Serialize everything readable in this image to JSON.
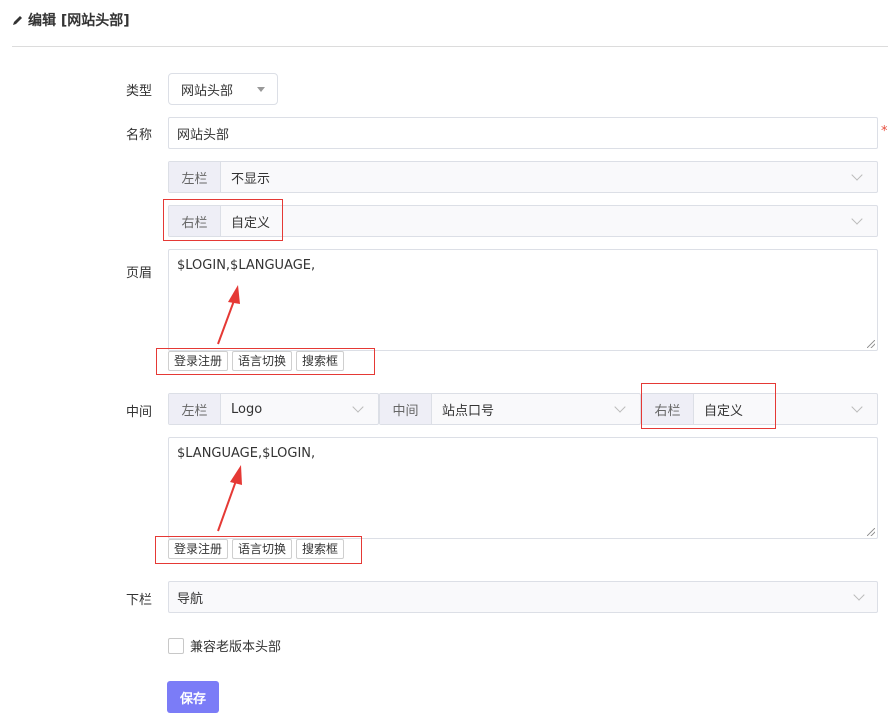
{
  "title": "编辑 [网站头部]",
  "colors": {
    "accent": "#7b7cf7",
    "required": "#e74c3c",
    "annotation": "#e53935"
  },
  "form": {
    "type_label": "类型",
    "type_value": "网站头部",
    "name_label": "名称",
    "name_value": "网站头部",
    "required_mark": "*",
    "top_left_addon": "左栏",
    "top_left_value": "不显示",
    "top_right_addon": "右栏",
    "top_right_value": "自定义",
    "header_label": "页眉",
    "header_text": "$LOGIN,$LANGUAGE,",
    "header_chips": [
      "登录注册",
      "语言切换",
      "搜索框"
    ],
    "middle_label": "中间",
    "mid_left_addon": "左栏",
    "mid_left_value": "Logo",
    "mid_center_addon": "中间",
    "mid_center_value": "站点口号",
    "mid_right_addon": "右栏",
    "mid_right_value": "自定义",
    "middle_text": "$LANGUAGE,$LOGIN,",
    "middle_chips": [
      "登录注册",
      "语言切换",
      "搜索框"
    ],
    "bottom_label": "下栏",
    "bottom_value": "导航",
    "compat_label": "兼容老版本头部",
    "compat_checked": false,
    "save_label": "保存"
  }
}
